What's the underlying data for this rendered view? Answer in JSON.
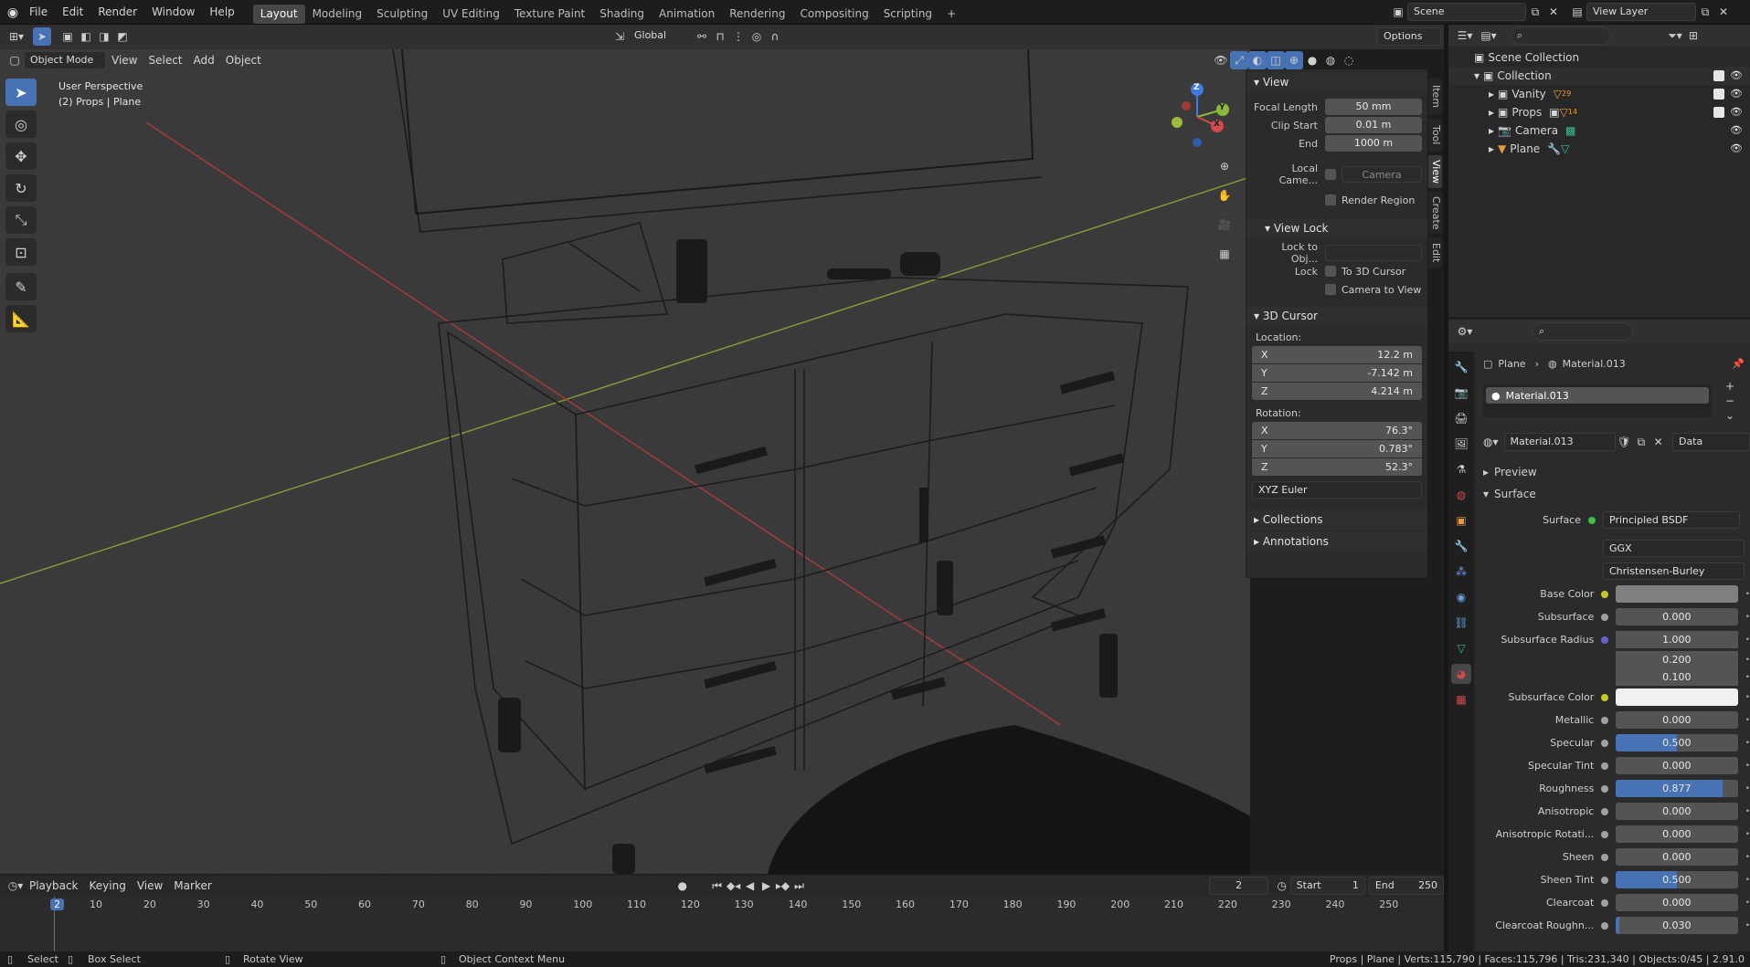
{
  "menu": [
    "File",
    "Edit",
    "Render",
    "Window",
    "Help"
  ],
  "workspaces": [
    "Layout",
    "Modeling",
    "Sculpting",
    "UV Editing",
    "Texture Paint",
    "Shading",
    "Animation",
    "Rendering",
    "Compositing",
    "Scripting"
  ],
  "active_workspace": "Layout",
  "scene": {
    "label": "Scene",
    "view_layer": "View Layer"
  },
  "viewport_header": {
    "transform_orientation": "Global",
    "options": "Options",
    "mode": "Object Mode",
    "menus": [
      "View",
      "Select",
      "Add",
      "Object"
    ]
  },
  "viewport_overlay": {
    "line1": "User Perspective",
    "line2": "(2) Props | Plane"
  },
  "gizmo": {
    "z": "Z",
    "y": "Y",
    "x": "X"
  },
  "npanel": {
    "tabs": [
      "Item",
      "Tool",
      "View",
      "Create",
      "Edit"
    ],
    "view_section": "View",
    "focal_length_label": "Focal Length",
    "focal_length": "50 mm",
    "clip_start_label": "Clip Start",
    "clip_start": "0.01 m",
    "end_label": "End",
    "end": "1000 m",
    "local_camera_label": "Local Came...",
    "local_camera": "Camera",
    "render_region": "Render Region",
    "view_lock_section": "View Lock",
    "lock_to_obj_label": "Lock to Obj...",
    "lock_label": "Lock",
    "to_3d_cursor": "To 3D Cursor",
    "camera_to_view": "Camera to View",
    "cursor_section": "3D Cursor",
    "location_label": "Location:",
    "loc": [
      {
        "axis": "X",
        "value": "12.2 m"
      },
      {
        "axis": "Y",
        "value": "-7.142 m"
      },
      {
        "axis": "Z",
        "value": "4.214 m"
      }
    ],
    "rotation_label": "Rotation:",
    "rot": [
      {
        "axis": "X",
        "value": "76.3°"
      },
      {
        "axis": "Y",
        "value": "0.783°"
      },
      {
        "axis": "Z",
        "value": "52.3°"
      }
    ],
    "rotation_mode": "XYZ Euler",
    "collections": "Collections",
    "annotations": "Annotations"
  },
  "outliner": {
    "items": [
      {
        "label": "Scene Collection",
        "indent": 0
      },
      {
        "label": "Collection",
        "indent": 1
      },
      {
        "label": "Vanity",
        "indent": 2,
        "badge": "29"
      },
      {
        "label": "Props",
        "indent": 2,
        "badge": "14"
      },
      {
        "label": "Camera",
        "indent": 2
      },
      {
        "label": "Plane",
        "indent": 2
      }
    ]
  },
  "properties": {
    "object": "Plane",
    "material": "Material.013",
    "slot": "Material.013",
    "data_link": "Data",
    "preview": "Preview",
    "surface_section": "Surface",
    "surface_label": "Surface",
    "surface_value": "Principled BSDF",
    "distribution": "GGX",
    "subsurface_method": "Christensen-Burley",
    "rows": [
      {
        "label": "Base Color",
        "value": "",
        "dot": "y",
        "kind": "color",
        "color": "#808080"
      },
      {
        "label": "Subsurface",
        "value": "0.000",
        "dot": "n",
        "fill": 0
      },
      {
        "label": "Subsurface Radius",
        "value": "1.000",
        "dot": "p",
        "fill": 0
      },
      {
        "label": "",
        "value": "0.200",
        "dot": "",
        "fill": 0
      },
      {
        "label": "",
        "value": "0.100",
        "dot": "",
        "fill": 0
      },
      {
        "label": "Subsurface Color",
        "value": "",
        "dot": "y",
        "kind": "color",
        "color": "#f0f0f0"
      },
      {
        "label": "Metallic",
        "value": "0.000",
        "dot": "n",
        "fill": 0
      },
      {
        "label": "Specular",
        "value": "0.500",
        "dot": "n",
        "fill": 0.5
      },
      {
        "label": "Specular Tint",
        "value": "0.000",
        "dot": "n",
        "fill": 0
      },
      {
        "label": "Roughness",
        "value": "0.877",
        "dot": "n",
        "fill": 0.877
      },
      {
        "label": "Anisotropic",
        "value": "0.000",
        "dot": "n",
        "fill": 0
      },
      {
        "label": "Anisotropic Rotati...",
        "value": "0.000",
        "dot": "n",
        "fill": 0
      },
      {
        "label": "Sheen",
        "value": "0.000",
        "dot": "n",
        "fill": 0
      },
      {
        "label": "Sheen Tint",
        "value": "0.500",
        "dot": "n",
        "fill": 0.5
      },
      {
        "label": "Clearcoat",
        "value": "0.000",
        "dot": "n",
        "fill": 0
      },
      {
        "label": "Clearcoat Roughn...",
        "value": "0.030",
        "dot": "n",
        "fill": 0.03
      }
    ]
  },
  "timeline": {
    "menus": [
      "Playback",
      "Keying",
      "View",
      "Marker"
    ],
    "current_frame": "2",
    "start_label": "Start",
    "start": "1",
    "end_label": "End",
    "end": "250",
    "ticks": [
      "2",
      "10",
      "20",
      "30",
      "40",
      "50",
      "60",
      "70",
      "80",
      "90",
      "100",
      "110",
      "120",
      "130",
      "140",
      "150",
      "160",
      "170",
      "180",
      "190",
      "200",
      "210",
      "220",
      "230",
      "240",
      "250"
    ]
  },
  "status": {
    "select": "Select",
    "box_select": "Box Select",
    "rotate_view": "Rotate View",
    "context_menu": "Object Context Menu",
    "stats": "Props | Plane | Verts:115,790 | Faces:115,796 | Tris:231,340 | Objects:0/45 | 2.91.0"
  },
  "colors": {
    "accent": "#4772b3",
    "x_axis": "#d24a4a",
    "y_axis": "#8bb93a",
    "z_axis": "#3f7be0"
  }
}
